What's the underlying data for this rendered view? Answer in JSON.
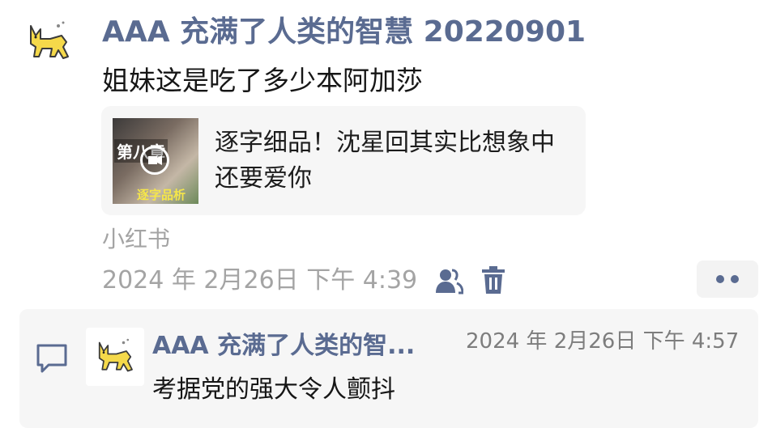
{
  "post": {
    "author": "AAA 充满了人类的智慧 20220901",
    "text": "姐妹这是吃了多少本阿加莎",
    "link_card": {
      "title": "逐字细品！沈星回其实比想象中还要爱你",
      "thumbnail_caption_top": "第八章",
      "thumbnail_caption_bottom": "逐字品析",
      "thumbnail_icon": "video-play-icon"
    },
    "source": "小红书",
    "timestamp": "2024 年 2月26日 下午 4:39",
    "icons": {
      "visibility": "person-visibility-icon",
      "delete": "trash-icon",
      "more": "more-dots-icon"
    }
  },
  "comments": [
    {
      "author": "AAA 充满了人类的智...",
      "time": "2024 年 2月26日 下午 4:57",
      "text": "考据党的强大令人颤抖"
    }
  ],
  "colors": {
    "name_blue": "#5a6b91",
    "text": "#161616",
    "muted": "#a4a4a4",
    "card_bg": "#f6f6f6",
    "avatar_yellow": "#f5d94a"
  }
}
